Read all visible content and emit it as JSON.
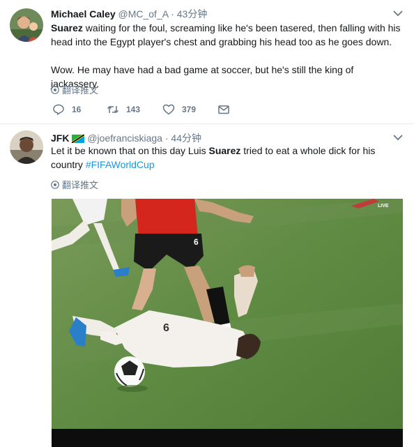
{
  "tweets": [
    {
      "name": "Michael Caley",
      "handle": "@MC_of_A",
      "separator": "·",
      "time": "43分钟",
      "text_bold": "Suarez",
      "text_rest": " waiting for the foul, screaming like he's been tasered, then falling with his head into the Egypt player's chest and grabbing his head too as he goes down.",
      "text_para2": "Wow. He may have had a bad game at soccer, but he's still the king of jackassery.",
      "translate_label": "翻译推文",
      "replies": "16",
      "retweets": "143",
      "likes": "379"
    },
    {
      "name": "JFK",
      "handle": "@joefranciskiaga",
      "separator": "·",
      "time": "44分钟",
      "text_before": "Let it be known that on this day Luis ",
      "text_bold": "Suarez",
      "text_after": " tried to eat a whole dick for his country ",
      "hashtag": "#FIFAWorldCup",
      "translate_label": "翻译推文",
      "media_overlay": "LIVE",
      "jersey_number": "6"
    }
  ],
  "icons": {
    "caret": "chevron-down-icon",
    "globe": "globe-icon",
    "reply": "reply-icon",
    "retweet": "retweet-icon",
    "like": "heart-icon",
    "message": "envelope-icon",
    "flag": "tanzania-flag-icon"
  },
  "colors": {
    "name": "#14171a",
    "secondary": "#657786",
    "link": "#1b95e0",
    "divider": "#e6ecf0"
  }
}
